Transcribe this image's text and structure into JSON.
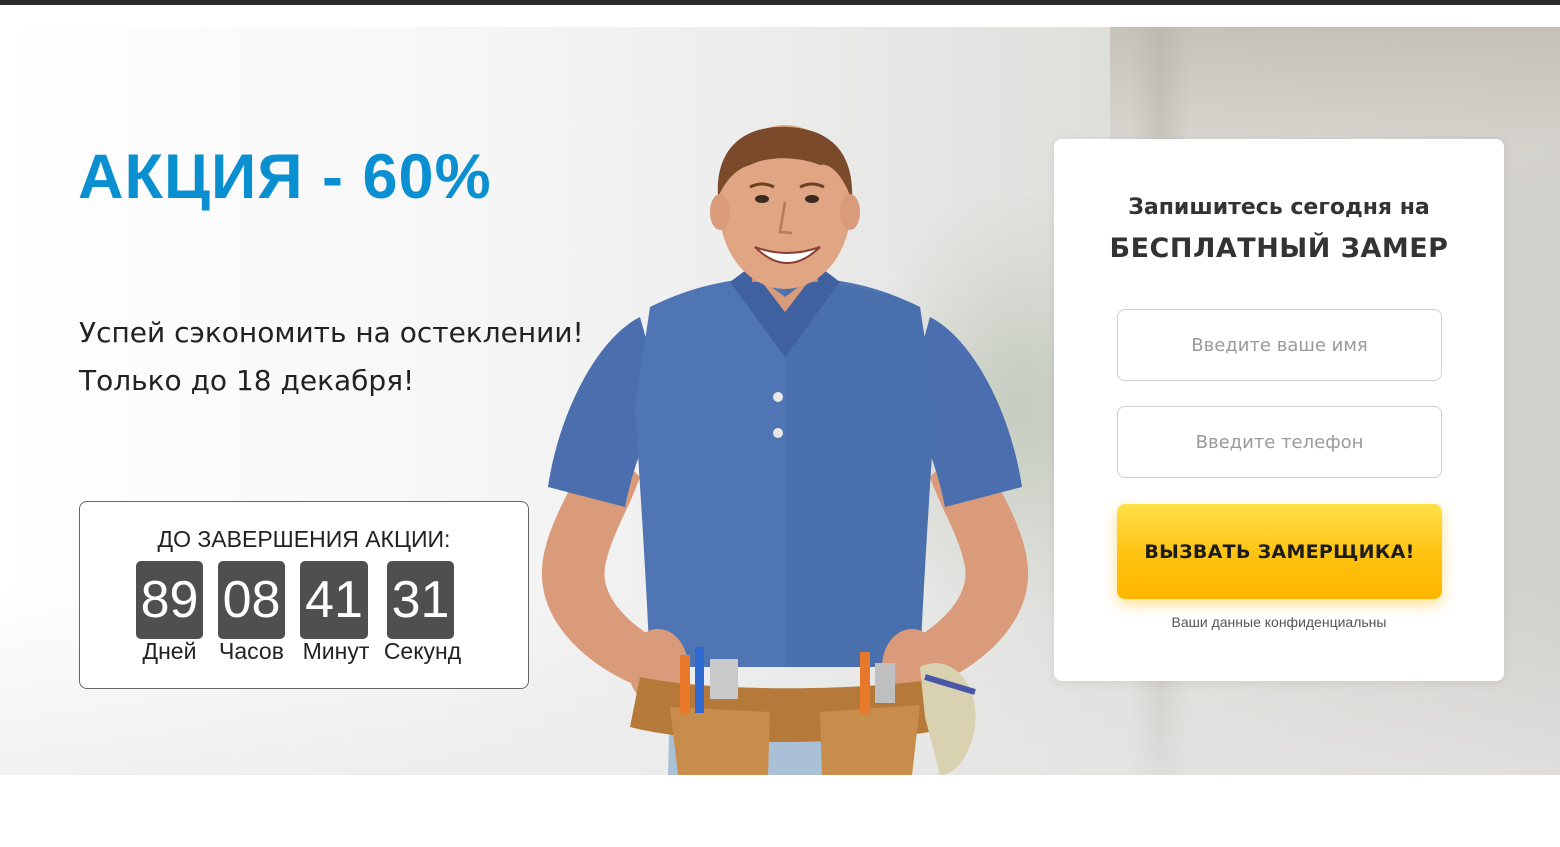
{
  "promo": {
    "title": "АКЦИЯ - 60%",
    "line1": "Успей сэкономить на остеклении!",
    "line2": "Только до 18 декабря!"
  },
  "countdown": {
    "title": "ДО ЗАВЕРШЕНИЯ АКЦИИ:",
    "days": "89",
    "hours": "08",
    "minutes": "41",
    "seconds": "31",
    "days_label": "Дней",
    "hours_label": "Часов",
    "minutes_label": "Минут",
    "seconds_label": "Секунд"
  },
  "form": {
    "subtitle": "Запишитесь сегодня на",
    "heading": "БЕСПЛАТНЫЙ ЗАМЕР",
    "name_placeholder": "Введите ваше имя",
    "phone_placeholder": "Введите телефон",
    "submit_label": "ВЫЗВАТЬ ЗАМЕРЩИКА!",
    "privacy_note": "Ваши данные конфиденциальны"
  },
  "colors": {
    "accent_blue": "#0a8fd1",
    "cta_yellow": "#ffc20f",
    "timer_box": "#4f4f4f"
  }
}
